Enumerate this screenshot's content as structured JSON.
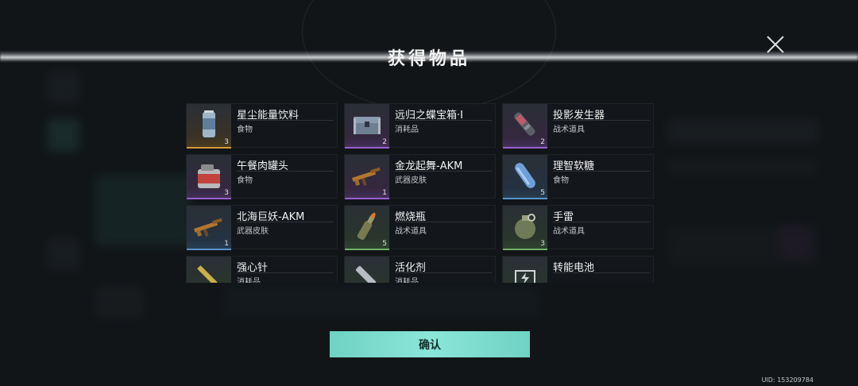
{
  "dialog": {
    "title": "获得物品",
    "confirm_label": "确认",
    "uid": "UID: 153209784"
  },
  "items": [
    {
      "name": "星尘能量饮料",
      "type": "食物",
      "count": "3",
      "rarity": "orange",
      "icon": "energy-drink-can-icon"
    },
    {
      "name": "远归之蝶宝箱·I",
      "type": "消耗品",
      "count": "2",
      "rarity": "purple",
      "icon": "treasure-chest-icon"
    },
    {
      "name": "投影发生器",
      "type": "战术道具",
      "count": "2",
      "rarity": "purple",
      "icon": "projection-generator-icon"
    },
    {
      "name": "午餐肉罐头",
      "type": "食物",
      "count": "3",
      "rarity": "purple",
      "icon": "canned-meat-icon"
    },
    {
      "name": "金龙起舞-AKM",
      "type": "武器皮肤",
      "count": "1",
      "rarity": "purple",
      "icon": "akm-rifle-icon"
    },
    {
      "name": "理智软糖",
      "type": "食物",
      "count": "5",
      "rarity": "blue",
      "icon": "capsule-candy-icon"
    },
    {
      "name": "北海巨妖-AKM",
      "type": "武器皮肤",
      "count": "1",
      "rarity": "blue",
      "icon": "akm-rifle-icon"
    },
    {
      "name": "燃烧瓶",
      "type": "战术道具",
      "count": "5",
      "rarity": "green",
      "icon": "molotov-icon"
    },
    {
      "name": "手雷",
      "type": "战术道具",
      "count": "3",
      "rarity": "green",
      "icon": "grenade-icon"
    },
    {
      "name": "强心针",
      "type": "消耗品",
      "count": "",
      "rarity": "green",
      "icon": "syringe-icon"
    },
    {
      "name": "活化剂",
      "type": "消耗品",
      "count": "",
      "rarity": "green",
      "icon": "injector-icon"
    },
    {
      "name": "转能电池",
      "type": "",
      "count": "",
      "rarity": "green",
      "icon": "battery-icon"
    }
  ]
}
